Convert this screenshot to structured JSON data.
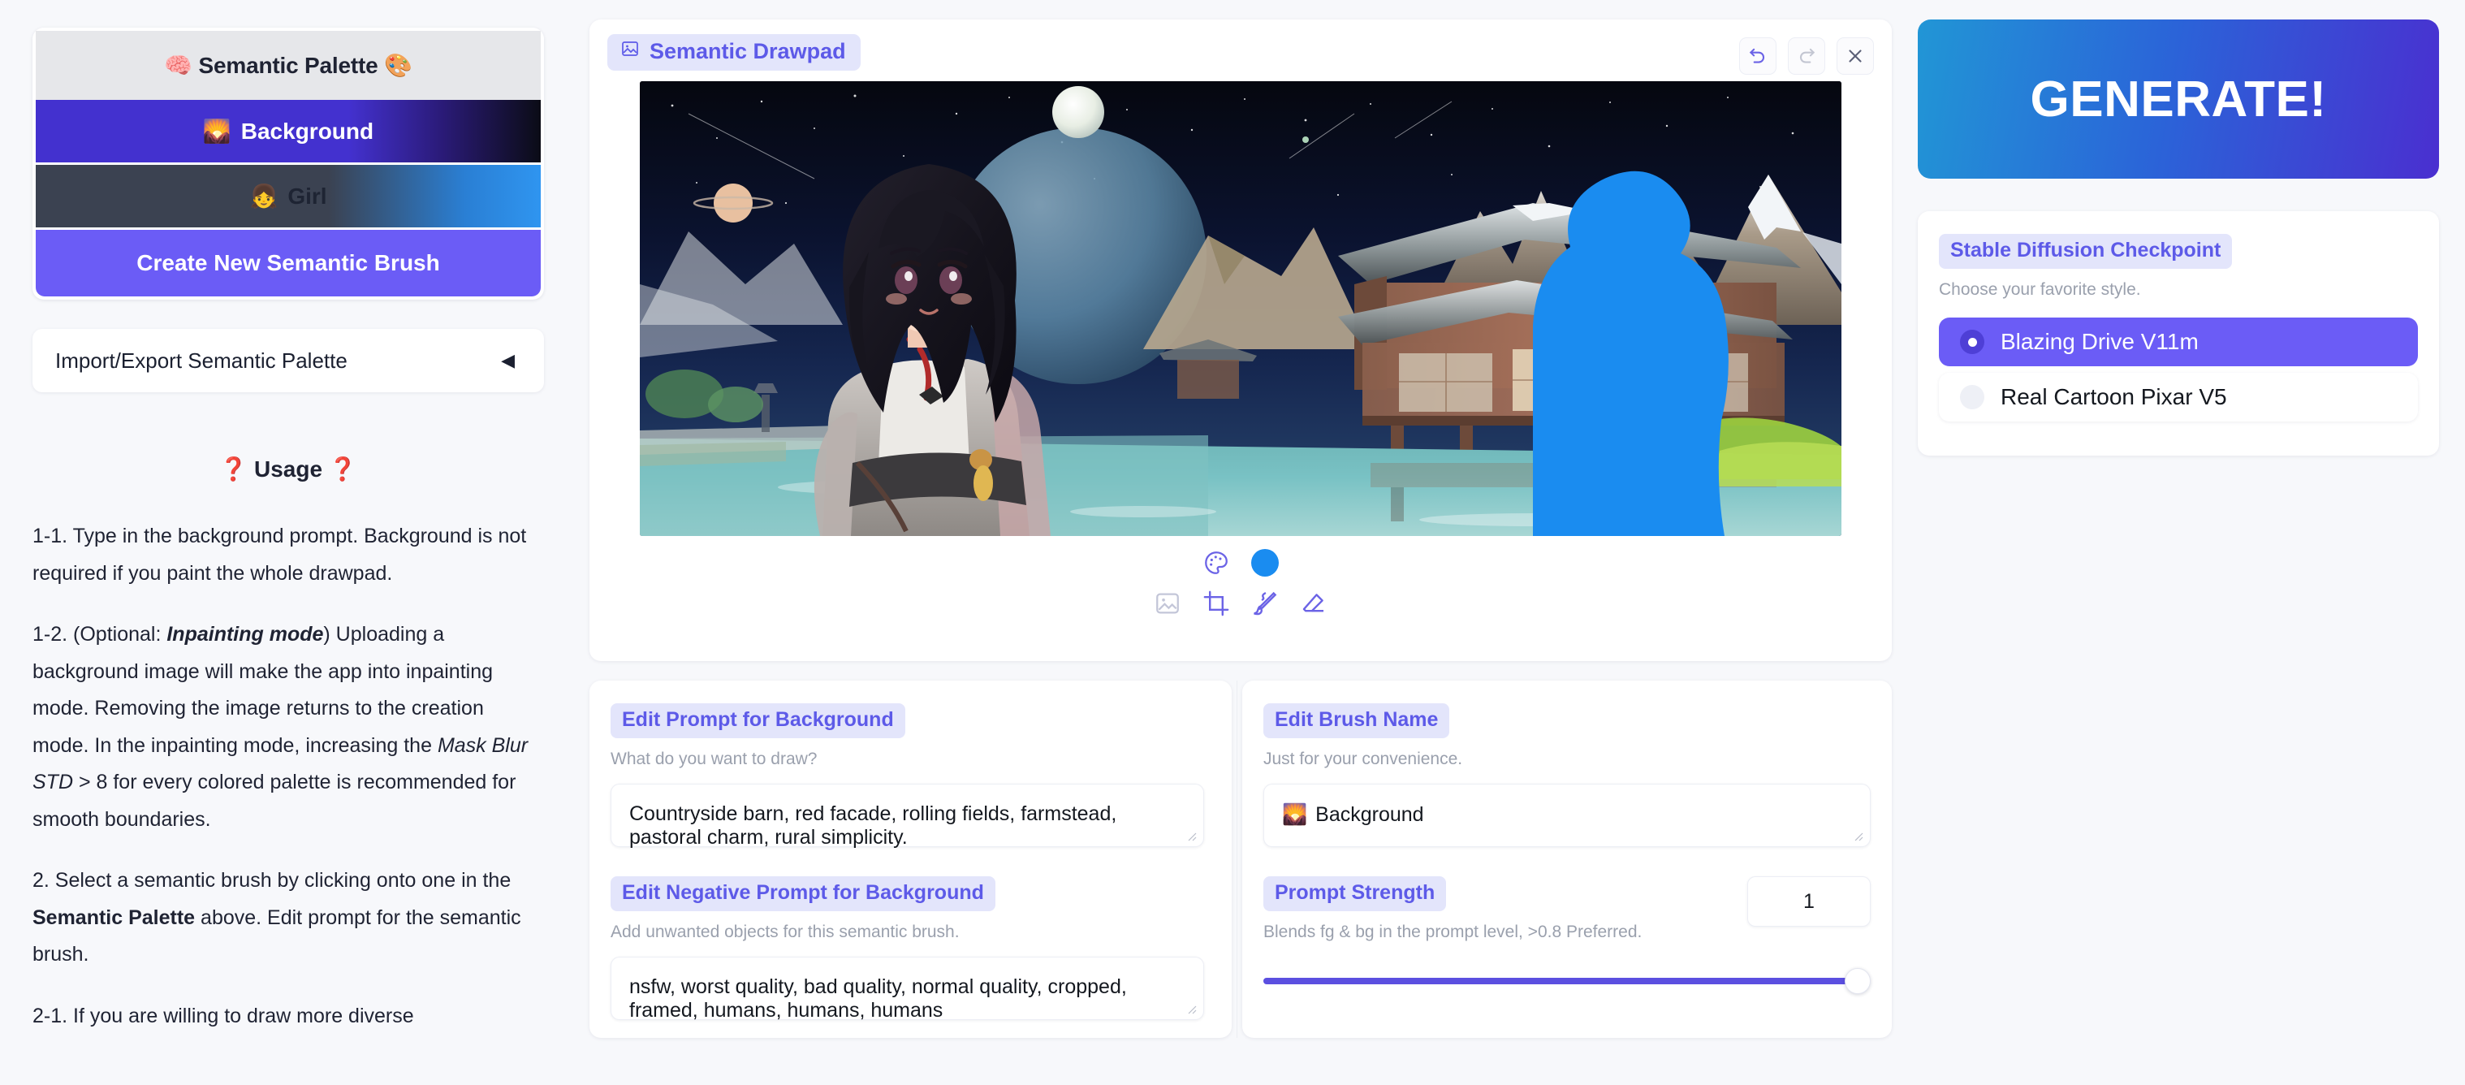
{
  "palette": {
    "title": "Semantic Palette",
    "title_emoji_left": "🧠",
    "title_emoji_right": "🎨",
    "brushes": [
      {
        "emoji": "🌄",
        "label": "Background",
        "selected": true
      },
      {
        "emoji": "👧",
        "label": "Girl",
        "selected": false
      }
    ],
    "create_brush_label": "Create New Semantic Brush",
    "import_export_label": "Import/Export Semantic Palette",
    "import_export_caret": "◀"
  },
  "usage": {
    "heading": "Usage",
    "heading_mark": "❓",
    "paragraphs": [
      {
        "runs": [
          {
            "t": "1-1. Type in the background prompt. Background is not required if you paint the whole drawpad.",
            "s": "n"
          }
        ]
      },
      {
        "runs": [
          {
            "t": "1-2. (Optional: ",
            "s": "n"
          },
          {
            "t": "Inpainting mode",
            "s": "bi"
          },
          {
            "t": ") Uploading a background image will make the app into inpainting mode. Removing the image returns to the creation mode. In the inpainting mode, increasing the ",
            "s": "n"
          },
          {
            "t": "Mask Blur STD",
            "s": "i"
          },
          {
            "t": " > 8 for every colored palette is recommended for smooth boundaries.",
            "s": "n"
          }
        ]
      },
      {
        "runs": [
          {
            "t": "2. Select a semantic brush by clicking onto one in the ",
            "s": "n"
          },
          {
            "t": "Semantic Palette",
            "s": "b"
          },
          {
            "t": " above. Edit prompt for the semantic brush.",
            "s": "n"
          }
        ]
      },
      {
        "runs": [
          {
            "t": "2-1. If you are willing to draw more diverse",
            "s": "n"
          }
        ]
      }
    ]
  },
  "drawpad": {
    "title": "Semantic Drawpad",
    "title_icon": "image-icon",
    "controls": [
      {
        "name": "undo-button",
        "icon": "undo-icon",
        "enabled": true
      },
      {
        "name": "redo-button",
        "icon": "redo-icon",
        "enabled": false
      },
      {
        "name": "close-button",
        "icon": "close-icon",
        "enabled": true
      }
    ],
    "active_color": "#1a8cf0",
    "tools": [
      {
        "name": "palette-tool",
        "icon": "palette-icon"
      },
      {
        "name": "color-swatch",
        "icon": "color-dot-icon"
      },
      {
        "name": "upload-image-tool",
        "icon": "image-icon"
      },
      {
        "name": "crop-tool",
        "icon": "crop-icon"
      },
      {
        "name": "brush-tool",
        "icon": "brush-icon"
      },
      {
        "name": "eraser-tool",
        "icon": "eraser-icon"
      }
    ],
    "canvas_alt": "Anime girl in grey hanfu standing before a moonlit Japanese temple over a turquoise pond, with a blue painted semantic mask silhouette on the right"
  },
  "prompt_background": {
    "pill": "Edit Prompt for Background",
    "hint": "What do you want to draw?",
    "value": "Countryside barn, red facade, rolling fields, farmstead, pastoral charm, rural simplicity."
  },
  "negative_prompt_background": {
    "pill": "Edit Negative Prompt for Background",
    "hint": "Add unwanted objects for this semantic brush.",
    "value": "nsfw, worst quality, bad quality, normal quality, cropped, framed, humans, humans, humans"
  },
  "brush_name": {
    "pill": "Edit Brush Name",
    "hint": "Just for your convenience.",
    "emoji": "🌄",
    "value": "Background"
  },
  "prompt_strength": {
    "pill": "Prompt Strength",
    "hint": "Blends fg & bg in the prompt level, >0.8 Preferred.",
    "value": "1",
    "fill_percent": 98
  },
  "generate": {
    "label": "GENERATE!",
    "gradient_from": "#2196d6",
    "gradient_to": "#4a2fd0"
  },
  "checkpoint": {
    "pill": "Stable Diffusion Checkpoint",
    "hint": "Choose your favorite style.",
    "options": [
      {
        "label": "Blazing Drive V11m",
        "selected": true
      },
      {
        "label": "Real Cartoon Pixar V5",
        "selected": false
      }
    ]
  },
  "colors": {
    "accent": "#5d5ae8",
    "accent_soft": "#e3e5fb",
    "brush_blue": "#1a8cf0",
    "selected_brush": "#4331cf",
    "create_button": "#6b5cf6"
  }
}
